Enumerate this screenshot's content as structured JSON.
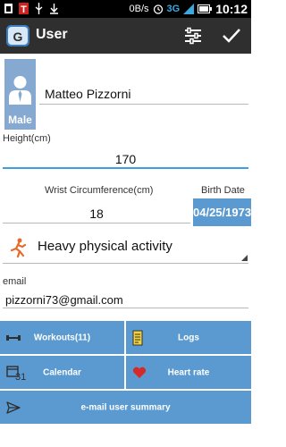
{
  "status_bar": {
    "speed": "0B/s",
    "network": "3G",
    "time": "10:12"
  },
  "action_bar": {
    "title": "User",
    "icons": [
      "app-logo-icon",
      "sliders-icon",
      "checkmark-icon"
    ]
  },
  "profile": {
    "gender": "Male",
    "name": "Matteo Pizzorni",
    "height_label": "Height(cm)",
    "height_value": "170",
    "wrist_label": "Wrist Circumference(cm)",
    "wrist_value": "18",
    "birth_label": "Birth Date",
    "birth_value": "04/25/1973",
    "activity": "Heavy physical activity",
    "email_label": "email",
    "email_value": "pizzorni73@gmail.com"
  },
  "buttons": {
    "workouts": "Workouts(11)",
    "logs": "Logs",
    "calendar": "Calendar",
    "calendar_icon_num": "31",
    "heart_rate": "Heart rate",
    "email_summary": "e-mail user summary"
  },
  "colors": {
    "accent": "#5b9ad0",
    "avatar_bg": "#86a9d1",
    "action_bar": "#2f2f2f",
    "focus_line": "#3f9ee0",
    "heart": "#d42a2a",
    "runner": "#e86a2a"
  }
}
